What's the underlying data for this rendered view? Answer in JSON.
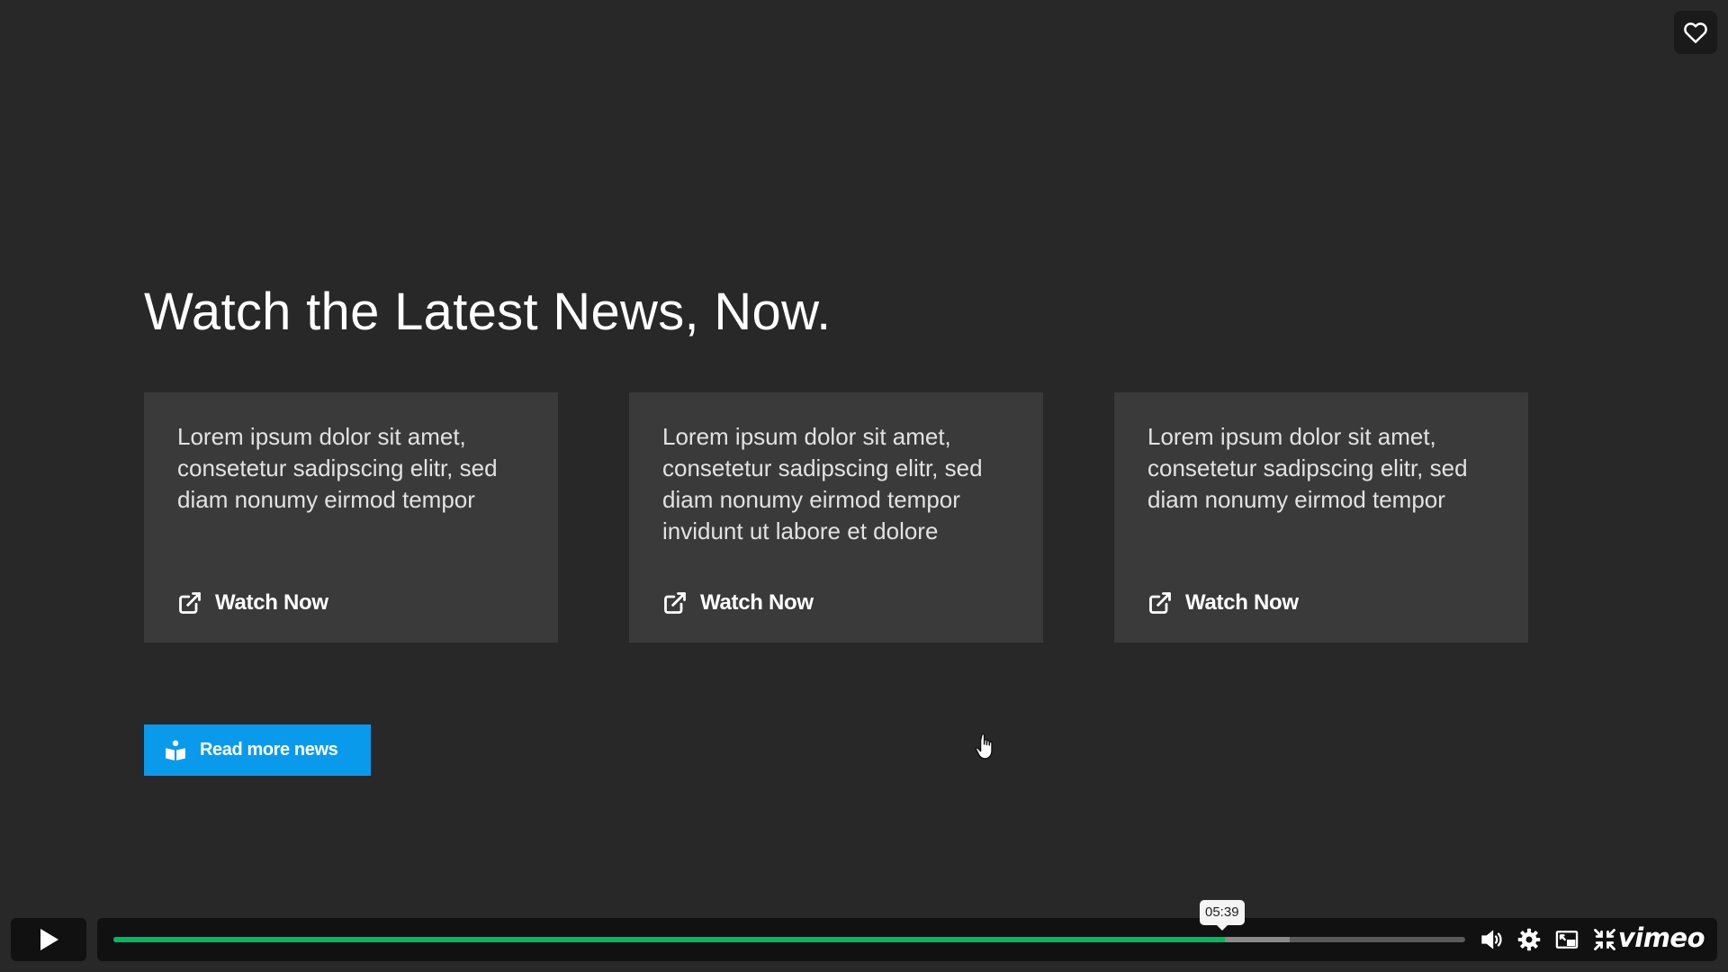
{
  "page": {
    "headline": "Watch the Latest News, Now."
  },
  "cards": [
    {
      "text": "Lorem ipsum dolor sit amet, consetetur sadipscing elitr, sed diam nonumy eirmod tempor",
      "link_label": "Watch Now",
      "link_icon": "external-link-icon"
    },
    {
      "text": "Lorem ipsum dolor sit amet, consetetur sadipscing elitr, sed diam nonumy eirmod tempor invidunt ut labore et dolore",
      "link_label": "Watch Now",
      "link_icon": "external-link-icon"
    },
    {
      "text": "Lorem ipsum dolor sit amet, consetetur sadipscing elitr, sed diam nonumy eirmod tempor",
      "link_label": "Watch Now",
      "link_icon": "external-link-icon"
    }
  ],
  "read_more": {
    "label": "Read more news",
    "icon": "reader-icon",
    "color": "#0a9aec"
  },
  "player": {
    "hover_time": "05:39",
    "played_fraction": 0.822,
    "buffered_fraction": 0.87,
    "progress_color": "#00b85f",
    "brand": "vimeo",
    "icons": [
      "heart-icon",
      "play-icon",
      "volume-icon",
      "settings-icon",
      "pip-icon",
      "exit-fullscreen-icon"
    ]
  }
}
